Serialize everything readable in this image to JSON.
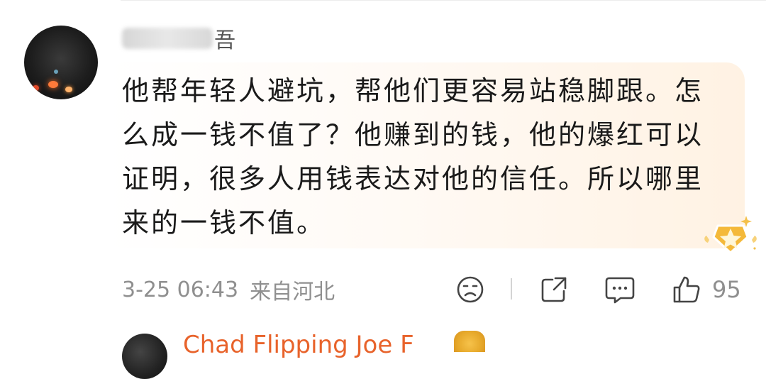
{
  "comment": {
    "username_visible_part": "吾",
    "text": "他帮年轻人避坑，帮他们更容易站稳脚跟。怎么成一钱不值了？他赚到的钱，他的爆红可以证明，很多人用钱表达对他的信任。所以哪里来的一钱不值。",
    "time": "3-25 06:43",
    "location": "来自河北",
    "like_count": "95"
  },
  "icons": {
    "emoji": "sad-face-icon",
    "share": "share-icon",
    "reply": "comment-bubble-icon",
    "like": "thumbs-up-icon",
    "badge": "star-badge-icon"
  },
  "next_comment": {
    "username_partial": "Chad Flipping Joe F"
  },
  "colors": {
    "text": "#1a1a1a",
    "meta": "#8f8f8f",
    "username_accent": "#e8632b",
    "bubble_tint": "#fff2e3"
  }
}
